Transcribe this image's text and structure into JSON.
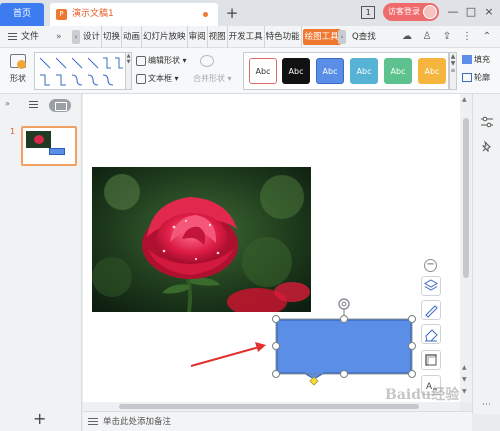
{
  "tabs": {
    "home_label": "首页",
    "doc_icon": "P",
    "doc_title": "演示文稿1",
    "add_label": "+",
    "window_count": "1",
    "login_label": "访客登录"
  },
  "window_controls": {
    "minimize": "—",
    "maximize": "□",
    "close": "×"
  },
  "menu": {
    "file_label": "文件",
    "more_label": "»",
    "items": [
      "设计",
      "切换",
      "动画",
      "幻灯片放映",
      "审阅",
      "视图",
      "开发工具",
      "特色功能",
      "绘图工具"
    ],
    "active_index": 8,
    "search_label": "Q查找"
  },
  "ribbon": {
    "shape_label": "形状",
    "edit_shape_label": "编辑形状",
    "textbox_label": "文本框",
    "merge_shape_label": "合并形状",
    "styles": [
      {
        "label": "Abc",
        "bg": "#ffffff",
        "border": "#e06a6a",
        "color": "#333333"
      },
      {
        "label": "Abc",
        "bg": "#111111",
        "border": "#111111",
        "color": "#ffffff"
      },
      {
        "label": "Abc",
        "bg": "#5b8ee6",
        "border": "#3a6cc4",
        "color": "#ffffff"
      },
      {
        "label": "Abc",
        "bg": "#56b3d6",
        "border": "#56b3d6",
        "color": "#ffffff"
      },
      {
        "label": "Abc",
        "bg": "#5dc28d",
        "border": "#5dc28d",
        "color": "#ffffff"
      },
      {
        "label": "Abc",
        "bg": "#f6b53e",
        "border": "#f6b53e",
        "color": "#ffffff"
      }
    ],
    "fill_label": "填充",
    "outline_label": "轮廓"
  },
  "left_panel": {
    "slide_number": "1",
    "add_label": "+"
  },
  "notes": {
    "placeholder": "单击此处添加备注"
  },
  "watermark": "Baidu经验"
}
